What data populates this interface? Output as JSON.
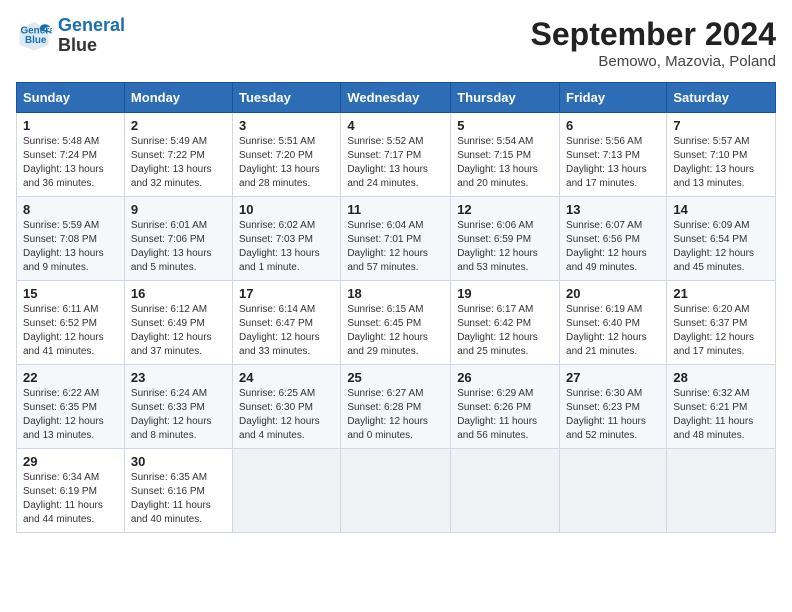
{
  "logo": {
    "line1": "General",
    "line2": "Blue"
  },
  "title": "September 2024",
  "subtitle": "Bemowo, Mazovia, Poland",
  "days_of_week": [
    "Sunday",
    "Monday",
    "Tuesday",
    "Wednesday",
    "Thursday",
    "Friday",
    "Saturday"
  ],
  "weeks": [
    [
      {
        "num": "1",
        "lines": [
          "Sunrise: 5:48 AM",
          "Sunset: 7:24 PM",
          "Daylight: 13 hours",
          "and 36 minutes."
        ]
      },
      {
        "num": "2",
        "lines": [
          "Sunrise: 5:49 AM",
          "Sunset: 7:22 PM",
          "Daylight: 13 hours",
          "and 32 minutes."
        ]
      },
      {
        "num": "3",
        "lines": [
          "Sunrise: 5:51 AM",
          "Sunset: 7:20 PM",
          "Daylight: 13 hours",
          "and 28 minutes."
        ]
      },
      {
        "num": "4",
        "lines": [
          "Sunrise: 5:52 AM",
          "Sunset: 7:17 PM",
          "Daylight: 13 hours",
          "and 24 minutes."
        ]
      },
      {
        "num": "5",
        "lines": [
          "Sunrise: 5:54 AM",
          "Sunset: 7:15 PM",
          "Daylight: 13 hours",
          "and 20 minutes."
        ]
      },
      {
        "num": "6",
        "lines": [
          "Sunrise: 5:56 AM",
          "Sunset: 7:13 PM",
          "Daylight: 13 hours",
          "and 17 minutes."
        ]
      },
      {
        "num": "7",
        "lines": [
          "Sunrise: 5:57 AM",
          "Sunset: 7:10 PM",
          "Daylight: 13 hours",
          "and 13 minutes."
        ]
      }
    ],
    [
      {
        "num": "8",
        "lines": [
          "Sunrise: 5:59 AM",
          "Sunset: 7:08 PM",
          "Daylight: 13 hours",
          "and 9 minutes."
        ]
      },
      {
        "num": "9",
        "lines": [
          "Sunrise: 6:01 AM",
          "Sunset: 7:06 PM",
          "Daylight: 13 hours",
          "and 5 minutes."
        ]
      },
      {
        "num": "10",
        "lines": [
          "Sunrise: 6:02 AM",
          "Sunset: 7:03 PM",
          "Daylight: 13 hours",
          "and 1 minute."
        ]
      },
      {
        "num": "11",
        "lines": [
          "Sunrise: 6:04 AM",
          "Sunset: 7:01 PM",
          "Daylight: 12 hours",
          "and 57 minutes."
        ]
      },
      {
        "num": "12",
        "lines": [
          "Sunrise: 6:06 AM",
          "Sunset: 6:59 PM",
          "Daylight: 12 hours",
          "and 53 minutes."
        ]
      },
      {
        "num": "13",
        "lines": [
          "Sunrise: 6:07 AM",
          "Sunset: 6:56 PM",
          "Daylight: 12 hours",
          "and 49 minutes."
        ]
      },
      {
        "num": "14",
        "lines": [
          "Sunrise: 6:09 AM",
          "Sunset: 6:54 PM",
          "Daylight: 12 hours",
          "and 45 minutes."
        ]
      }
    ],
    [
      {
        "num": "15",
        "lines": [
          "Sunrise: 6:11 AM",
          "Sunset: 6:52 PM",
          "Daylight: 12 hours",
          "and 41 minutes."
        ]
      },
      {
        "num": "16",
        "lines": [
          "Sunrise: 6:12 AM",
          "Sunset: 6:49 PM",
          "Daylight: 12 hours",
          "and 37 minutes."
        ]
      },
      {
        "num": "17",
        "lines": [
          "Sunrise: 6:14 AM",
          "Sunset: 6:47 PM",
          "Daylight: 12 hours",
          "and 33 minutes."
        ]
      },
      {
        "num": "18",
        "lines": [
          "Sunrise: 6:15 AM",
          "Sunset: 6:45 PM",
          "Daylight: 12 hours",
          "and 29 minutes."
        ]
      },
      {
        "num": "19",
        "lines": [
          "Sunrise: 6:17 AM",
          "Sunset: 6:42 PM",
          "Daylight: 12 hours",
          "and 25 minutes."
        ]
      },
      {
        "num": "20",
        "lines": [
          "Sunrise: 6:19 AM",
          "Sunset: 6:40 PM",
          "Daylight: 12 hours",
          "and 21 minutes."
        ]
      },
      {
        "num": "21",
        "lines": [
          "Sunrise: 6:20 AM",
          "Sunset: 6:37 PM",
          "Daylight: 12 hours",
          "and 17 minutes."
        ]
      }
    ],
    [
      {
        "num": "22",
        "lines": [
          "Sunrise: 6:22 AM",
          "Sunset: 6:35 PM",
          "Daylight: 12 hours",
          "and 13 minutes."
        ]
      },
      {
        "num": "23",
        "lines": [
          "Sunrise: 6:24 AM",
          "Sunset: 6:33 PM",
          "Daylight: 12 hours",
          "and 8 minutes."
        ]
      },
      {
        "num": "24",
        "lines": [
          "Sunrise: 6:25 AM",
          "Sunset: 6:30 PM",
          "Daylight: 12 hours",
          "and 4 minutes."
        ]
      },
      {
        "num": "25",
        "lines": [
          "Sunrise: 6:27 AM",
          "Sunset: 6:28 PM",
          "Daylight: 12 hours",
          "and 0 minutes."
        ]
      },
      {
        "num": "26",
        "lines": [
          "Sunrise: 6:29 AM",
          "Sunset: 6:26 PM",
          "Daylight: 11 hours",
          "and 56 minutes."
        ]
      },
      {
        "num": "27",
        "lines": [
          "Sunrise: 6:30 AM",
          "Sunset: 6:23 PM",
          "Daylight: 11 hours",
          "and 52 minutes."
        ]
      },
      {
        "num": "28",
        "lines": [
          "Sunrise: 6:32 AM",
          "Sunset: 6:21 PM",
          "Daylight: 11 hours",
          "and 48 minutes."
        ]
      }
    ],
    [
      {
        "num": "29",
        "lines": [
          "Sunrise: 6:34 AM",
          "Sunset: 6:19 PM",
          "Daylight: 11 hours",
          "and 44 minutes."
        ]
      },
      {
        "num": "30",
        "lines": [
          "Sunrise: 6:35 AM",
          "Sunset: 6:16 PM",
          "Daylight: 11 hours",
          "and 40 minutes."
        ]
      },
      null,
      null,
      null,
      null,
      null
    ]
  ]
}
